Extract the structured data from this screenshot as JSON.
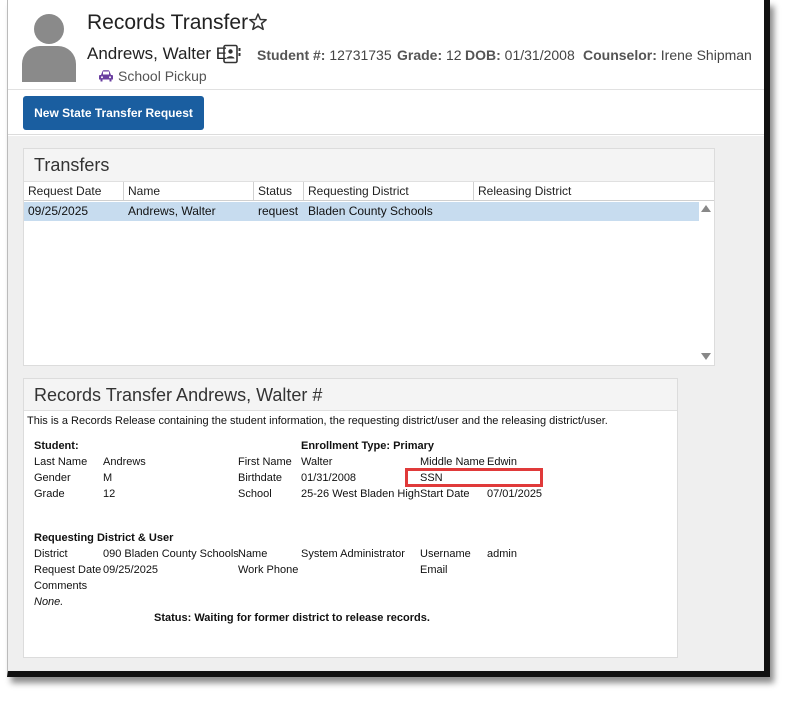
{
  "header": {
    "title": "Records Transfer",
    "student_name": "Andrews, Walter E",
    "student_num_label": "Student #:",
    "student_num": "12731735",
    "grade_label": "Grade:",
    "grade": "12",
    "dob_label": "DOB:",
    "dob": "01/31/2008",
    "counselor_label": "Counselor:",
    "counselor": "Irene Shipman",
    "pickup": "School Pickup"
  },
  "toolbar": {
    "new_request_label": "New State Transfer Request"
  },
  "transfers": {
    "title": "Transfers",
    "columns": [
      "Request Date",
      "Name",
      "Status",
      "Requesting District",
      "Releasing District"
    ],
    "rows": [
      [
        "09/25/2025",
        "Andrews, Walter",
        "request",
        "Bladen County Schools",
        ""
      ]
    ]
  },
  "records": {
    "title": "Records Transfer Andrews, Walter #",
    "intro": "This is a Records Release containing the student information, the requesting district/user and the releasing district/user.",
    "student_heading": "Student:",
    "enrollment_type": "Enrollment Type: Primary",
    "last_name_label": "Last Name",
    "last_name": "Andrews",
    "gender_label": "Gender",
    "gender": "M",
    "grade_label": "Grade",
    "grade": "12",
    "first_name_label": "First Name",
    "first_name": "Walter",
    "birthdate_label": "Birthdate",
    "birthdate": "01/31/2008",
    "school_label": "School",
    "school": "25-26 West Bladen High",
    "middle_name_label": "Middle Name",
    "middle_name": "Edwin",
    "ssn_label": "SSN",
    "start_date_label": "Start Date",
    "start_date": "07/01/2025",
    "requesting_heading": "Requesting District & User",
    "district_label": "District",
    "district": "090 Bladen County Schools",
    "request_date_label": "Request Date",
    "request_date": "09/25/2025",
    "comments_label": "Comments",
    "comments": "None.",
    "name_label": "Name",
    "name": "System Administrator",
    "work_phone_label": "Work Phone",
    "username_label": "Username",
    "username": "admin",
    "email_label": "Email",
    "status": "Status: Waiting for former district to release records."
  },
  "colors": {
    "primary_button": "#1a5ea0",
    "selected_row": "#c7dcef",
    "highlight_box": "#e03a3a",
    "car_icon": "#6a3fa0"
  }
}
